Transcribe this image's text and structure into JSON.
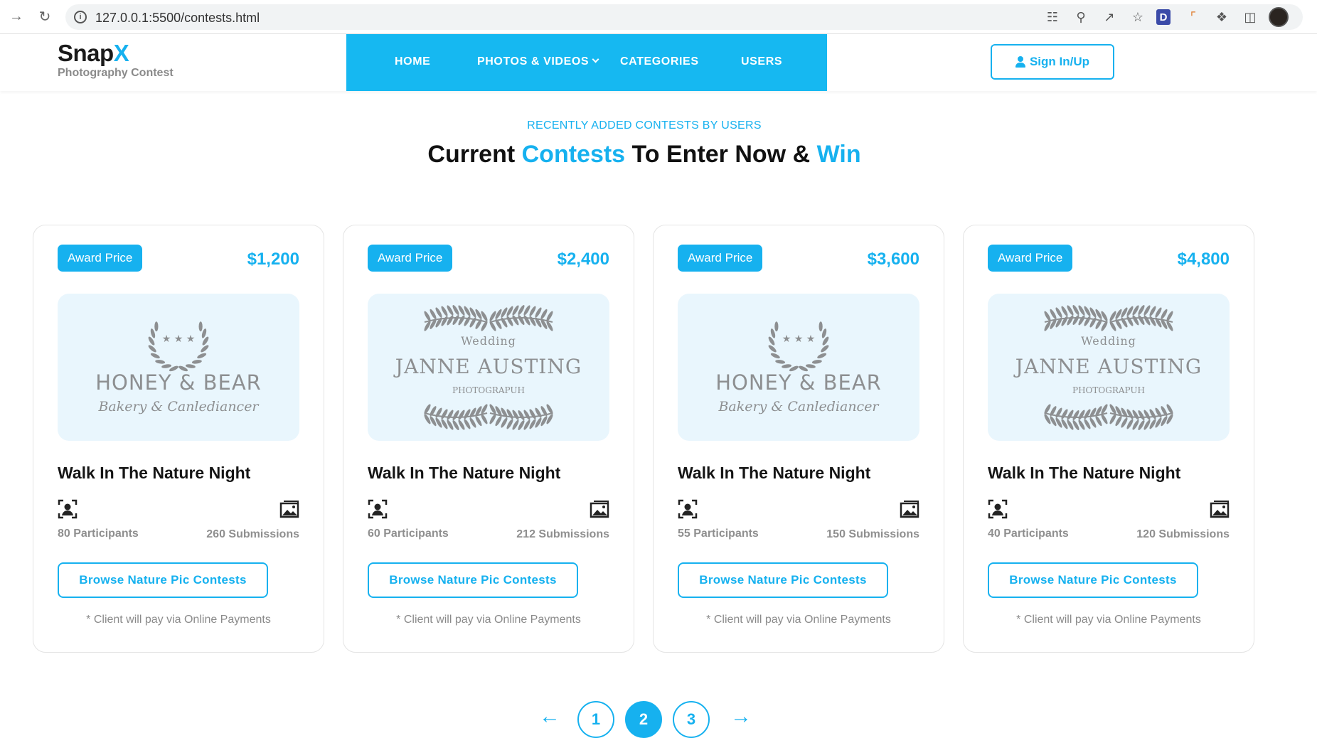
{
  "browser": {
    "url": "127.0.0.1:5500/contests.html",
    "icons": [
      "forward-icon",
      "reload-icon",
      "info-icon",
      "translate-icon",
      "zoom-icon",
      "share-icon",
      "star-icon",
      "d-extension-icon",
      "ruler-extension-icon",
      "puzzle-icon",
      "sidepanel-icon",
      "profile-avatar"
    ],
    "ext_letter": "D"
  },
  "header": {
    "logo_name": "Snap",
    "logo_mark": "X",
    "logo_tag": "Photography Contest",
    "nav": [
      "HOME",
      "PHOTOS & VIDEOS",
      "CATEGORIES",
      "USERS"
    ],
    "sign_in": "Sign In/Up"
  },
  "section": {
    "kicker": "RECENTLY ADDED CONTESTS BY USERS",
    "title_part1": "Current ",
    "title_highlight1": "Contests",
    "title_part2": " To Enter Now & ",
    "title_highlight2": "Win"
  },
  "cards": [
    {
      "badge": "Award Price",
      "price": "$1,200",
      "logo": {
        "style": "honey",
        "line1": "HONEY & BEAR",
        "line2": "Bakery & Canlediancer",
        "stars": "★ ★ ★"
      },
      "title": "Walk In The Nature Night",
      "participants": "80 Participants",
      "submissions": "260 Submissions",
      "button": "Browse Nature Pic Contests",
      "note": "* Client will pay via Online Payments"
    },
    {
      "badge": "Award Price",
      "price": "$2,400",
      "logo": {
        "style": "wedding",
        "line0": "Wedding",
        "line1": "JANNE AUSTING",
        "line2": "PHOTOGRAPUH"
      },
      "title": "Walk In The Nature Night",
      "participants": "60 Participants",
      "submissions": "212 Submissions",
      "button": "Browse Nature Pic Contests",
      "note": "* Client will pay via Online Payments"
    },
    {
      "badge": "Award Price",
      "price": "$3,600",
      "logo": {
        "style": "honey",
        "line1": "HONEY & BEAR",
        "line2": "Bakery & Canlediancer",
        "stars": "★ ★ ★"
      },
      "title": "Walk In The Nature Night",
      "participants": "55 Participants",
      "submissions": "150 Submissions",
      "button": "Browse Nature Pic Contests",
      "note": "* Client will pay via Online Payments"
    },
    {
      "badge": "Award Price",
      "price": "$4,800",
      "logo": {
        "style": "wedding",
        "line0": "Wedding",
        "line1": "JANNE AUSTING",
        "line2": "PHOTOGRAPUH"
      },
      "title": "Walk In The Nature Night",
      "participants": "40 Participants",
      "submissions": "120 Submissions",
      "button": "Browse Nature Pic Contests",
      "note": "* Client will pay via Online Payments"
    }
  ],
  "pagination": {
    "prev": "←",
    "pages": [
      "1",
      "2",
      "3"
    ],
    "active": "2",
    "next": "→"
  },
  "colors": {
    "accent": "#16b1ef",
    "nav_bg": "#16b8f1",
    "thumb_bg": "#e9f6fd",
    "muted": "#8f8f8f"
  }
}
